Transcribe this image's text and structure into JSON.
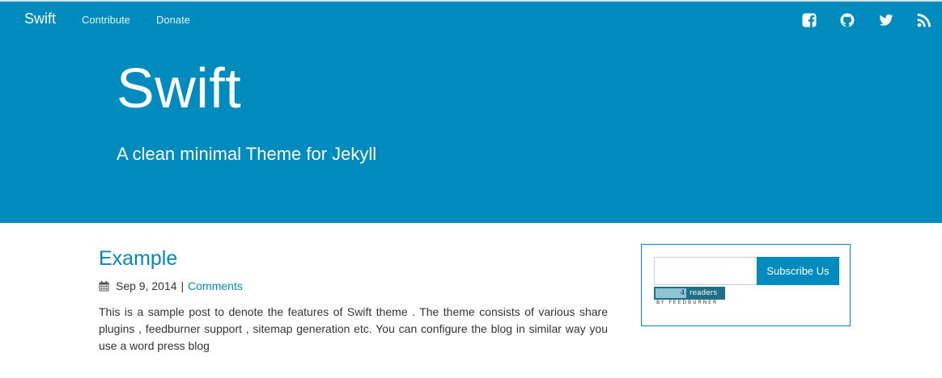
{
  "navbar": {
    "brand": "Swift",
    "links": [
      {
        "label": "Contribute"
      },
      {
        "label": "Donate"
      }
    ],
    "social": [
      {
        "icon": "facebook-icon"
      },
      {
        "icon": "github-icon"
      },
      {
        "icon": "twitter-icon"
      },
      {
        "icon": "rss-icon"
      }
    ]
  },
  "hero": {
    "title": "Swift",
    "subtitle": "A clean minimal Theme for Jekyll"
  },
  "post": {
    "title": "Example",
    "date": "Sep 9, 2014",
    "separator": "|",
    "comments_label": "Comments",
    "excerpt": "This is a sample post to denote the features of Swift theme . The theme consists of various share plugins , feedburner support , sitemap generation etc. You can configure the blog in similar way you use a word press blog"
  },
  "subscribe": {
    "input_value": "",
    "button_label": "Subscribe Us",
    "feedburner": {
      "count": "4",
      "readers_label": "readers",
      "by_label": "BY FEEDBURNER"
    }
  },
  "colors": {
    "brand": "#008bbf",
    "link": "#0088bf",
    "text": "#333333"
  }
}
